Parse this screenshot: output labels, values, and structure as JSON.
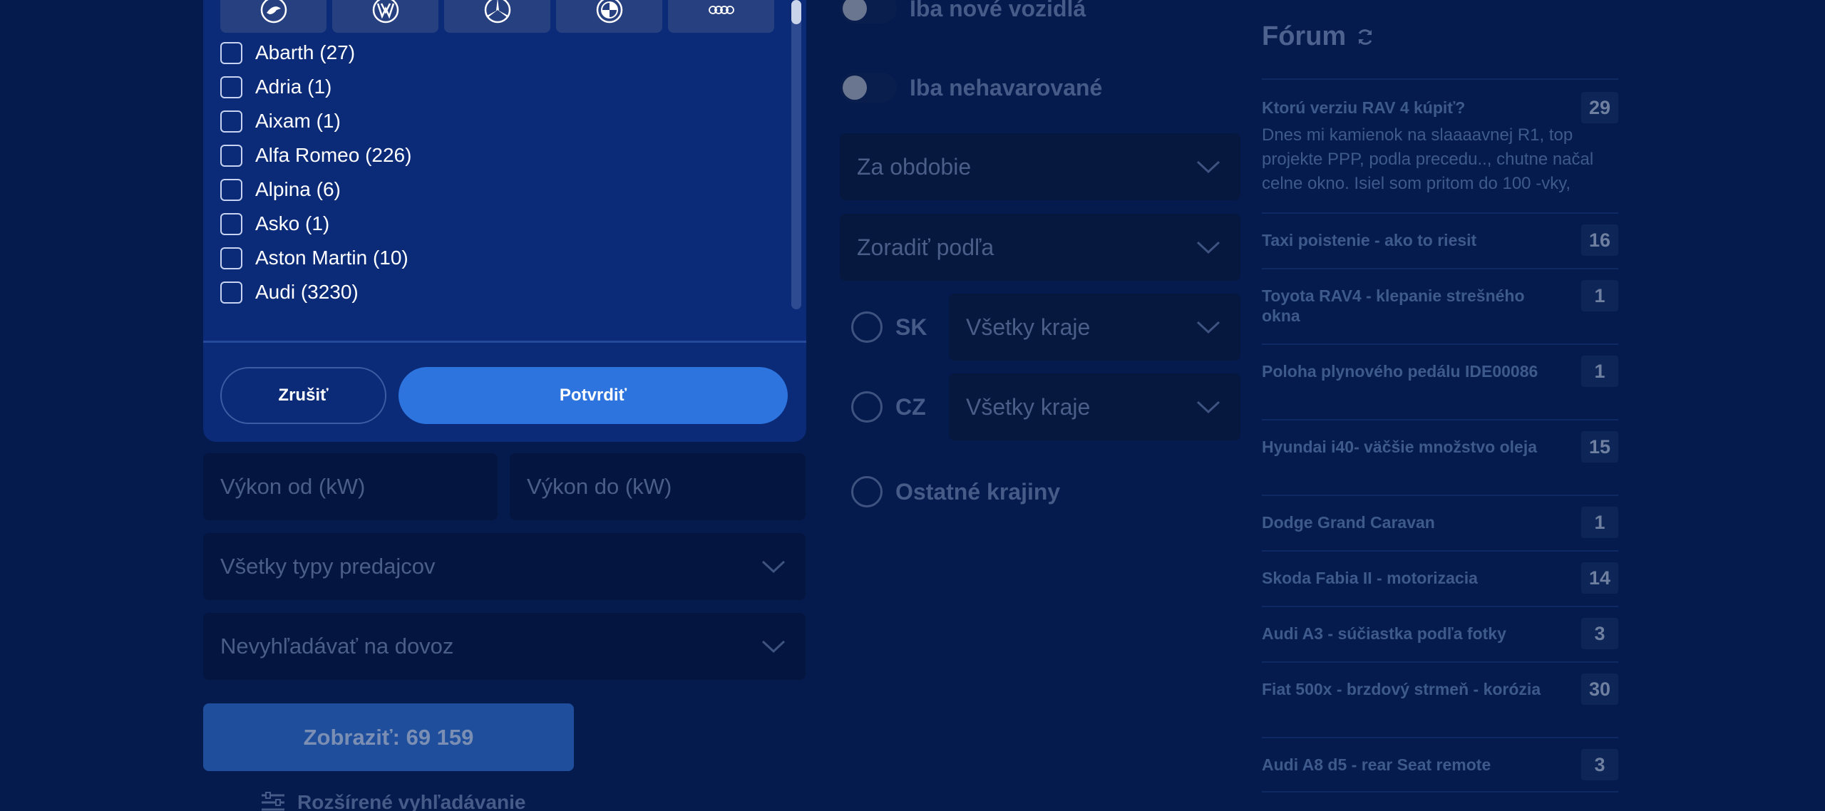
{
  "brand_panel": {
    "logos": [
      {
        "name": "skoda-logo-icon"
      },
      {
        "name": "volkswagen-logo-icon"
      },
      {
        "name": "mercedes-logo-icon"
      },
      {
        "name": "bmw-logo-icon"
      },
      {
        "name": "audi-logo-icon"
      }
    ],
    "brands": [
      {
        "label": "Abarth (27)"
      },
      {
        "label": "Adria (1)"
      },
      {
        "label": "Aixam (1)"
      },
      {
        "label": "Alfa Romeo (226)"
      },
      {
        "label": "Alpina (6)"
      },
      {
        "label": "Asko (1)"
      },
      {
        "label": "Aston Martin (10)"
      },
      {
        "label": "Audi (3230)"
      }
    ],
    "cancel_label": "Zrušiť",
    "confirm_label": "Potvrdiť"
  },
  "filters": {
    "power_from_placeholder": "Výkon od (kW)",
    "power_to_placeholder": "Výkon do (kW)",
    "seller_types": "Všetky typy predajcov",
    "import": "Nevyhľadávať na dovoz",
    "show_button": "Zobraziť: 69 159",
    "advanced_search": "Rozšírené vyhľadávanie"
  },
  "middle": {
    "toggle_new": "Iba nové vozidlá",
    "toggle_undamaged": "Iba nehavarované",
    "period": "Za obdobie",
    "sort_by": "Zoradiť podľa",
    "sk_label": "SK",
    "sk_regions": "Všetky kraje",
    "cz_label": "CZ",
    "cz_regions": "Všetky kraje",
    "other_countries": "Ostatné krajiny"
  },
  "forum": {
    "title": "Fórum",
    "items": [
      {
        "title": "Ktorú verziu RAV 4 kúpiť?",
        "count": "29",
        "preview": "Dnes mi kamienok na slaaaavnej R1, top projekte PPP, podla precedu.., chutne načal celne okno. Isiel som pritom do 100 -vky,"
      },
      {
        "title": "Taxi poistenie - ako to riesit",
        "count": "16"
      },
      {
        "title": "Toyota RAV4 - klepanie strešného okna",
        "count": "1"
      },
      {
        "title": "Poloha plynového pedálu IDE00086",
        "count": "1"
      },
      {
        "title": "Hyundai i40- väčšie množstvo oleja",
        "count": "15"
      },
      {
        "title": "Dodge Grand Caravan",
        "count": "1"
      },
      {
        "title": "Skoda Fabia II - motorizacia",
        "count": "14"
      },
      {
        "title": "Audi A3 - súčiastka podľa fotky",
        "count": "3"
      },
      {
        "title": "Fiat 500x - brzdový strmeň - korózia",
        "count": "30"
      },
      {
        "title": "Audi A8 d5 - rear Seat remote",
        "count": "3"
      }
    ]
  }
}
